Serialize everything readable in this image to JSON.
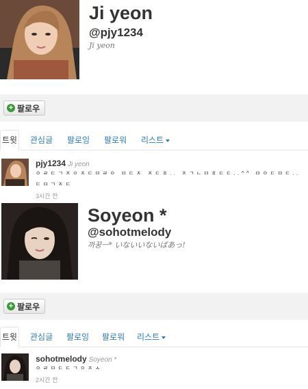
{
  "colors": {
    "link": "#2b7bb9",
    "follow_plus": "#3a9a3a",
    "bar_bg": "#f2f2f2"
  },
  "profiles": [
    {
      "name": "Ji yeon",
      "handle": "@pjy1234",
      "bio": "Ji yeon",
      "follow_label": "팔로우",
      "tabs": {
        "tweets": "트윗",
        "favorites": "관심글",
        "following": "팔로잉",
        "followers": "팔로워",
        "lists": "리스트"
      },
      "tweet": {
        "username": "pjy1234",
        "fullname": "Ji yeon",
        "text": "ㅇㄹㄷㄱㅈㅇㅈㄷㅁㄹㅇ ㅁㄷㅈ ㅈㄷㅎ.. ㅈㄱㄴㅁㅎㄷㄷ..^^ ㅁㅇㄷㅁㄷ..ㄷㅁㄱㅈㄷ",
        "time": "3시간 전"
      }
    },
    {
      "name": "Soyeon *",
      "handle": "@sohotmelody",
      "bio": "까꿍ㅡ* いないいないばあっ!",
      "follow_label": "팔로우",
      "tabs": {
        "tweets": "트윗",
        "favorites": "관심글",
        "following": "팔로잉",
        "followers": "팔로워",
        "lists": "리스트"
      },
      "tweet": {
        "username": "sohotmelody",
        "fullname": "Soyeon *",
        "text": "ㅇㄹㅁㄷㄷㄱㅇㅈㅅ",
        "time": "2시간 전"
      }
    }
  ]
}
